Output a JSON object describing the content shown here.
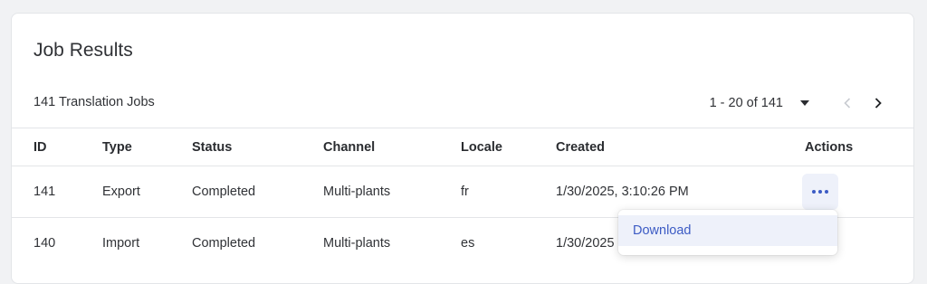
{
  "card": {
    "title": "Job Results",
    "job_count": "141 Translation Jobs"
  },
  "pagination": {
    "range": "1 - 20 of 141",
    "prev_enabled": false,
    "next_enabled": true,
    "icons": {
      "dropdown": "caret-down-icon",
      "prev": "chevron-left-icon",
      "next": "chevron-right-icon"
    }
  },
  "table": {
    "columns": [
      "ID",
      "Type",
      "Status",
      "Channel",
      "Locale",
      "Created",
      "Actions"
    ],
    "rows": [
      {
        "id": "141",
        "type": "Export",
        "status": "Completed",
        "channel": "Multi-plants",
        "locale": "fr",
        "created": "1/30/2025, 3:10:26 PM"
      },
      {
        "id": "140",
        "type": "Import",
        "status": "Completed",
        "channel": "Multi-plants",
        "locale": "es",
        "created": "1/30/2025"
      }
    ]
  },
  "actions_menu": {
    "items": [
      "Download"
    ]
  },
  "colors": {
    "accent": "#3c5bc4",
    "accent_bg": "#eef1fa",
    "border": "#e3e5e8",
    "page_bg": "#f1f2f4"
  }
}
